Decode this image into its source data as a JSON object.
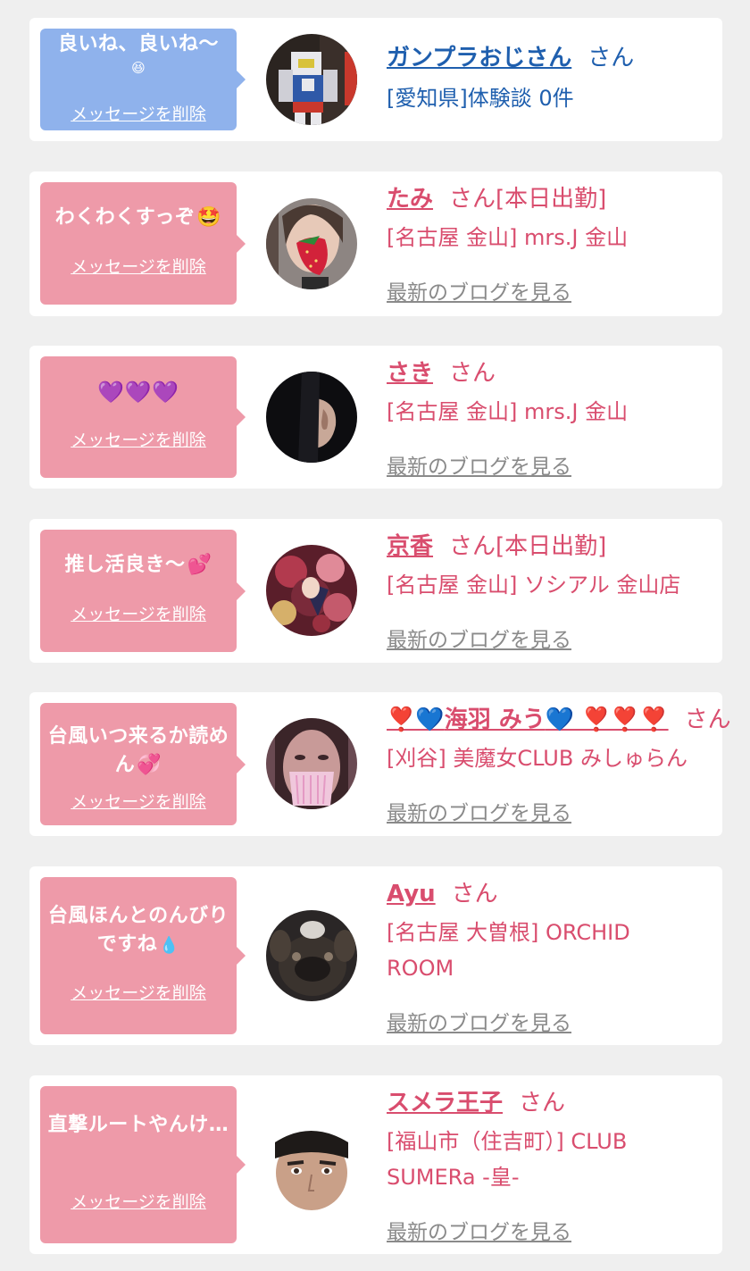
{
  "delete_label": "メッセージを削除",
  "blog_label": "最新のブログを見る",
  "honorific": "さん",
  "colors": {
    "page_bg": "#efefef",
    "card_bg": "#ffffff",
    "bubble_blue": "#8fb2ec",
    "bubble_pink": "#ee9aa9",
    "name_pink": "#d94d6e",
    "name_blue": "#1f5fae",
    "blog_link": "#8a8a8a"
  },
  "items": [
    {
      "message": "良いね、良いね〜",
      "message_emoji": "😆",
      "name": "ガンプラおじさん",
      "status": "",
      "shop": "[愛知県]体験談 0件",
      "has_blog": false,
      "theme": "blue",
      "avatar_icon": "gundam-figure-avatar"
    },
    {
      "message": "わくわくすっぞ",
      "message_emoji": "🤩",
      "name": "たみ",
      "status": "[本日出勤]",
      "shop": "[名古屋 金山] mrs.J 金山",
      "has_blog": true,
      "theme": "pink",
      "avatar_icon": "strawberry-face-avatar"
    },
    {
      "message": "",
      "message_emoji": "💜💜💜",
      "name": "さき",
      "status": "",
      "shop": "[名古屋 金山] mrs.J 金山",
      "has_blog": true,
      "theme": "pink",
      "avatar_icon": "ear-closeup-avatar"
    },
    {
      "message": "推し活良き〜",
      "message_emoji": "💕",
      "name": "京香",
      "status": "[本日出勤]",
      "shop": "[名古屋 金山] ソシアル 金山店",
      "has_blog": true,
      "theme": "pink",
      "avatar_icon": "kimono-avatar"
    },
    {
      "message": "台風いつ来るか読めん",
      "message_emoji": "💞",
      "name_prefix": "❣️💙",
      "name": "海羽 みう",
      "name_suffix": "💙 ❣️❣️❣️",
      "status": "",
      "shop": "[刈谷] 美魔女CLUB みしゅらん",
      "has_blog": true,
      "theme": "pink",
      "avatar_icon": "masked-face-avatar"
    },
    {
      "message": "台風ほんとのんびりですね",
      "message_emoji": "💧",
      "name": "Ayu",
      "status": "",
      "shop": "[名古屋 大曽根] ORCHID ROOM",
      "has_blog": true,
      "theme": "pink",
      "avatar_icon": "dog-avatar"
    },
    {
      "message": "直撃ルートやんけ…",
      "message_emoji": "",
      "name": "スメラ王子",
      "status": "",
      "shop": "[福山市（住吉町）] CLUB SUMERa -皇-",
      "has_blog": true,
      "theme": "pink",
      "avatar_icon": "man-face-avatar"
    }
  ]
}
